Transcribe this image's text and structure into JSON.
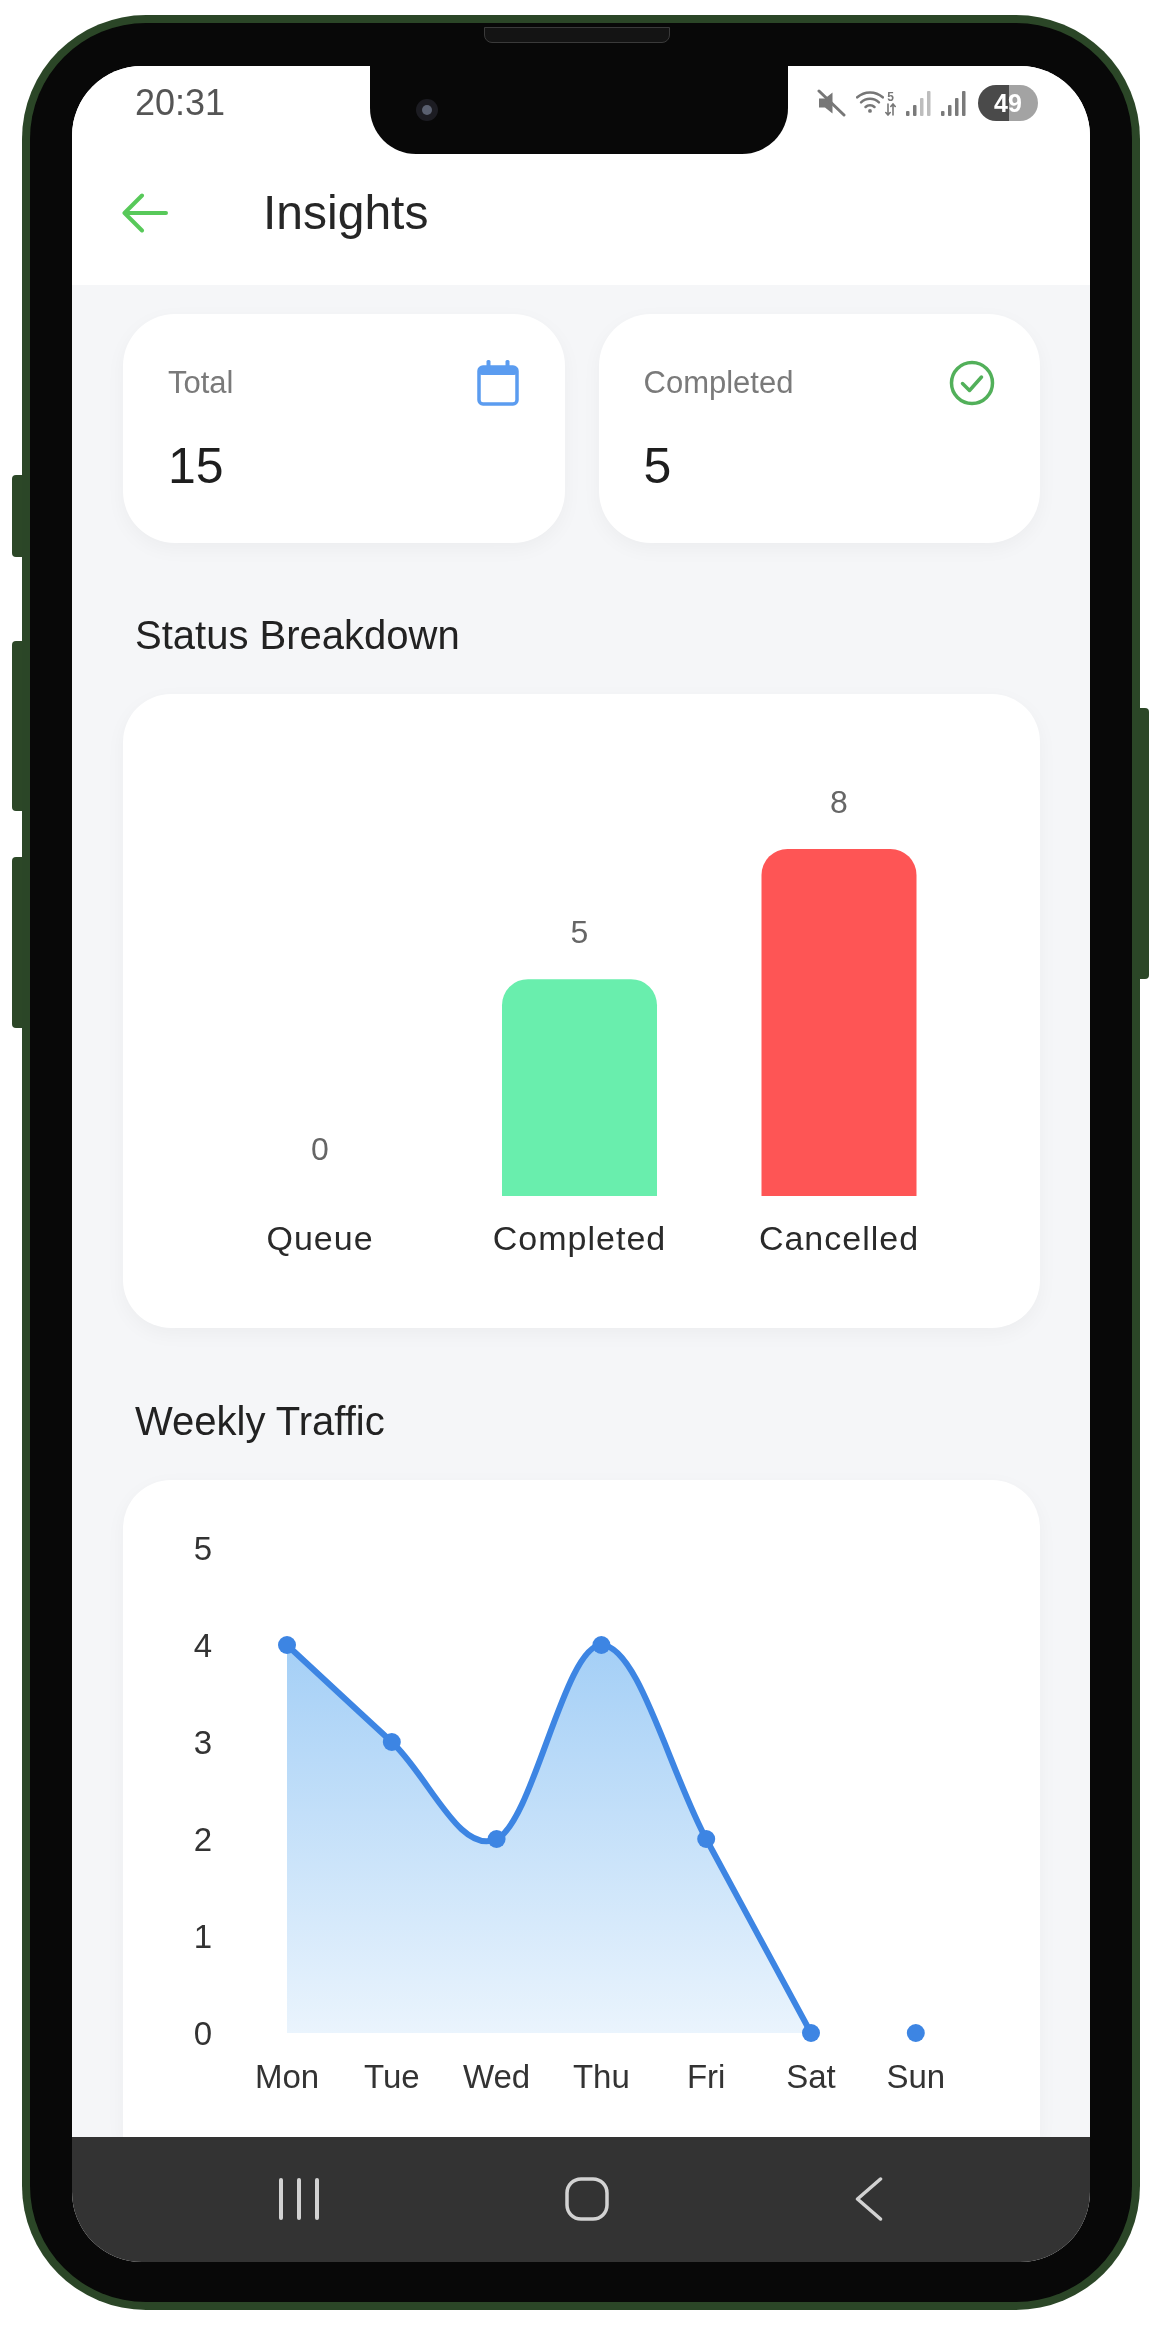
{
  "status_bar": {
    "time": "20:31",
    "wifi_label": "5",
    "battery": "49"
  },
  "header": {
    "title": "Insights"
  },
  "stats": [
    {
      "kind": "calendar",
      "label": "Total",
      "value": "15"
    },
    {
      "kind": "check",
      "label": "Completed",
      "value": "5"
    }
  ],
  "status_breakdown": {
    "title": "Status Breakdown",
    "chart_data": {
      "type": "bar",
      "categories": [
        "Queue",
        "Completed",
        "Cancelled"
      ],
      "values": [
        0,
        5,
        8
      ],
      "colors": [
        null,
        "#69eead",
        "#fe5555"
      ],
      "data_labels": true
    }
  },
  "weekly_traffic": {
    "title": "Weekly Traffic",
    "chart_data": {
      "type": "line",
      "categories": [
        "Mon",
        "Tue",
        "Wed",
        "Thu",
        "Fri",
        "Sat",
        "Sun"
      ],
      "series": [
        {
          "color": "#3d85e3",
          "marker": "circle",
          "values": [
            4,
            3,
            2,
            4,
            2,
            0,
            null
          ]
        },
        {
          "color": "#3d85e3",
          "marker": "circle",
          "values": [
            null,
            null,
            null,
            null,
            null,
            null,
            0
          ]
        }
      ],
      "ylim": [
        0,
        5
      ],
      "yticks": [
        0,
        1,
        2,
        3,
        4,
        5
      ]
    }
  }
}
